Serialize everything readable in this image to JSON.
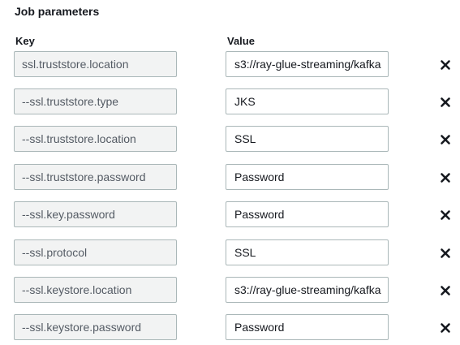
{
  "section": {
    "title": "Job parameters"
  },
  "columns": {
    "key": "Key",
    "value": "Value"
  },
  "colors": {
    "key_background": "#f2f3f3",
    "border": "#aab7b8",
    "key_text": "#545b64",
    "remove_icon": "#16191f"
  },
  "parameters": [
    {
      "key": "ssl.truststore.location",
      "value": "s3://ray-glue-streaming/kafka"
    },
    {
      "key": "--ssl.truststore.type",
      "value": "JKS"
    },
    {
      "key": "--ssl.truststore.location",
      "value": "SSL"
    },
    {
      "key": "--ssl.truststore.password",
      "value": "Password"
    },
    {
      "key": "--ssl.key.password",
      "value": "Password"
    },
    {
      "key": "--ssl.protocol",
      "value": "SSL"
    },
    {
      "key": "--ssl.keystore.location",
      "value": "s3://ray-glue-streaming/kafka"
    },
    {
      "key": "--ssl.keystore.password",
      "value": "Password"
    }
  ],
  "icons": {
    "remove": "close-x-icon"
  }
}
